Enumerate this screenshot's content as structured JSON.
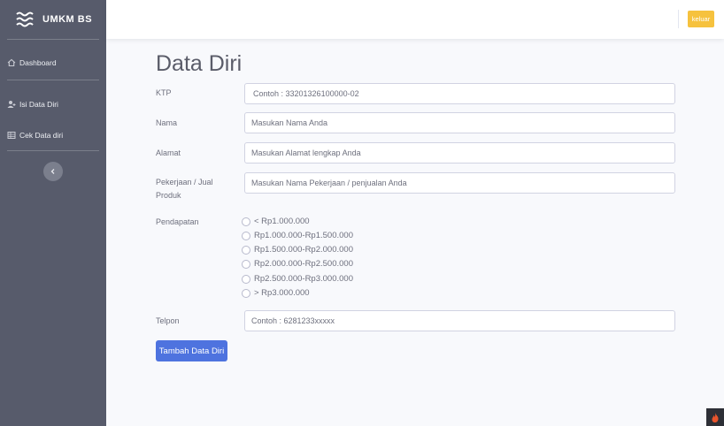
{
  "sidebar": {
    "brand": "UMKM BS",
    "items": [
      {
        "label": "Dashboard",
        "icon": "home-icon"
      },
      {
        "label": "Isi Data Diri",
        "icon": "user-plus-icon"
      },
      {
        "label": "Cek Data diri",
        "icon": "table-icon"
      }
    ],
    "toggle_icon": "chevron-left-icon"
  },
  "topbar": {
    "logout_label": "keluar"
  },
  "form": {
    "title": "Data Diri",
    "ktp": {
      "label": "KTP",
      "placeholder": "Contoh : 33201326100000-02"
    },
    "nama": {
      "label": "Nama",
      "placeholder": "Masukan Nama Anda"
    },
    "alamat": {
      "label": "Alamat",
      "placeholder": "Masukan Alamat lengkap Anda"
    },
    "pekerjaan": {
      "label_line1": "Pekerjaan / Jual",
      "label_line2": "Produk",
      "placeholder": "Masukan Nama Pekerjaan / penjualan Anda"
    },
    "pendapatan": {
      "label": "Pendapatan",
      "options": [
        "< Rp1.000.000",
        "Rp1.000.000-Rp1.500.000",
        "Rp1.500.000-Rp2.000.000",
        "Rp2.000.000-Rp2.500.000",
        "Rp2.500.000-Rp3.000.000",
        "> Rp3.000.000"
      ]
    },
    "telpon": {
      "label": "Telpon",
      "placeholder": "Contoh : 6281233xxxxx"
    },
    "submit_label": "Tambah Data Diri"
  },
  "colors": {
    "sidebar_bg": "#575b6b",
    "primary": "#4e73df",
    "warning": "#f6c23e"
  }
}
